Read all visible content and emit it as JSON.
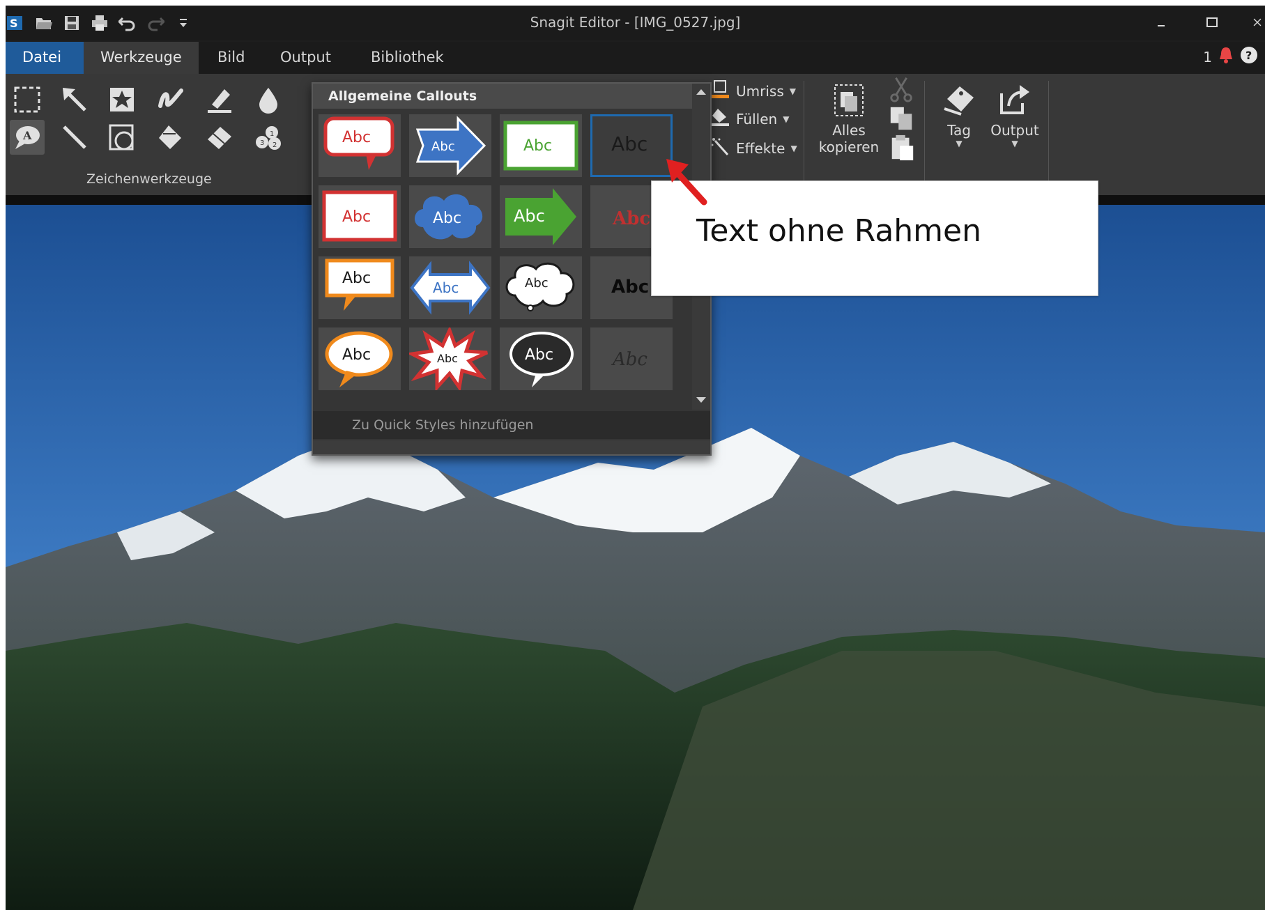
{
  "window": {
    "title": "Snagit Editor - [IMG_0527.jpg]"
  },
  "quick_access": [
    "app-logo",
    "open-icon",
    "save-icon",
    "print-icon",
    "undo-icon",
    "redo-icon",
    "customize-icon"
  ],
  "menu": {
    "items": [
      "Datei",
      "Werkzeuge",
      "Bild",
      "Output",
      "Bibliothek"
    ],
    "notification_count": "1"
  },
  "ribbon": {
    "group_label": "Zeichenwerkzeuge",
    "style_buttons": {
      "umriss": "Umriss",
      "fuellen": "Füllen",
      "effekte": "Effekte"
    },
    "copy_all": {
      "line1": "Alles",
      "line2": "kopieren"
    },
    "tag": "Tag",
    "output": "Output"
  },
  "callouts_panel": {
    "header": "Allgemeine Callouts",
    "footer": "Zu Quick Styles hinzufügen",
    "cell_text": "Abc",
    "rows": [
      [
        "speech-red",
        "arrow-blue",
        "box-green",
        "text-no-border"
      ],
      [
        "box-red",
        "cloud-blue",
        "arrow-green",
        "text-red-serif"
      ],
      [
        "speech-orange",
        "double-arrow-blue",
        "thought-cloud",
        "text-black-bold"
      ],
      [
        "oval-orange",
        "burst-red",
        "oval-dark",
        "text-italic"
      ]
    ]
  },
  "annotation": {
    "text": "Text ohne Rahmen"
  },
  "colors": {
    "accent": "#1f5b9a",
    "ribbon": "#383838",
    "panel": "#353535",
    "annotation_arrow": "#e02020"
  }
}
